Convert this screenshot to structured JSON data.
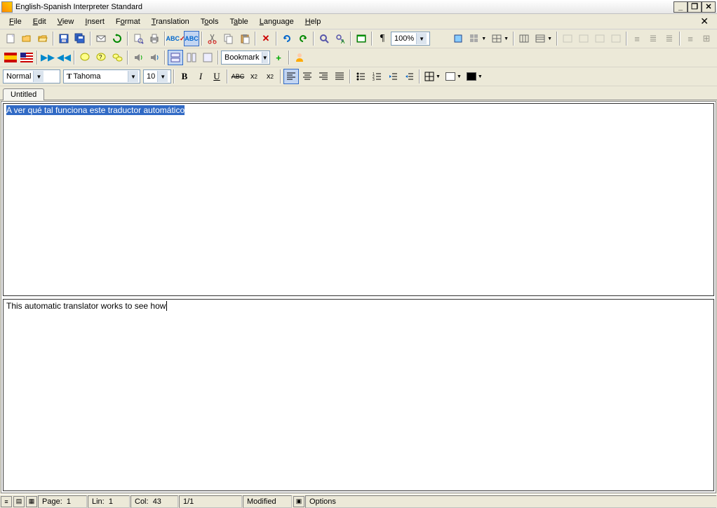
{
  "window": {
    "title": "English-Spanish Interpreter Standard"
  },
  "menu": {
    "items": [
      {
        "label": "File",
        "u": "F"
      },
      {
        "label": "Edit",
        "u": "E"
      },
      {
        "label": "View",
        "u": "V"
      },
      {
        "label": "Insert",
        "u": "I"
      },
      {
        "label": "Format",
        "u": "o"
      },
      {
        "label": "Translation",
        "u": "T"
      },
      {
        "label": "Tools",
        "u": "T"
      },
      {
        "label": "Table",
        "u": "a"
      },
      {
        "label": "Language",
        "u": "L"
      },
      {
        "label": "Help",
        "u": "H"
      }
    ]
  },
  "toolbar1": {
    "zoom": "100%"
  },
  "toolbar2": {
    "bookmark": "Bookmark"
  },
  "format_bar": {
    "style": "Normal",
    "font": "Tahoma",
    "size": "10",
    "bold": "B",
    "italic": "I",
    "underline": "U",
    "strike": "ABC",
    "sub": "x",
    "sup": "x"
  },
  "tabs": {
    "active": "Untitled"
  },
  "editor": {
    "source_text": "A ver qué tal funciona este traductor automático",
    "target_text": "This automatic translator works to see how"
  },
  "statusbar": {
    "page_label": "Page:",
    "page": "1",
    "lin_label": "Lin:",
    "lin": "1",
    "col_label": "Col:",
    "col": "43",
    "pages": "1/1",
    "modified": "Modified",
    "options": "Options"
  }
}
